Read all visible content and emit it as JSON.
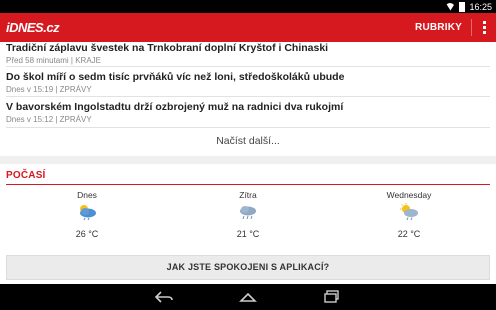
{
  "status_bar": {
    "time": "16:25"
  },
  "action_bar": {
    "logo": "iDNES.cz",
    "menu_label": "RUBRIKY"
  },
  "news": [
    {
      "title": "Tradiční záplavu švestek na Trnkobraní doplní Kryštof i Chinaski",
      "meta": "Před 58 minutami | KRAJE"
    },
    {
      "title": "Do škol míří o sedm tisíc prvňáků víc než loni, středoškoláků ubude",
      "meta": "Dnes v 15:19 | ZPRÁVY"
    },
    {
      "title": "V bavorském Ingolstadtu drží ozbrojený muž na radnici dva rukojmí",
      "meta": "Dnes v 15:12 | ZPRÁVY"
    }
  ],
  "load_more": "Načíst další...",
  "weather": {
    "section_title": "POČASÍ",
    "days": [
      {
        "name": "Dnes",
        "icon": "sun-behind-rain-cloud-icon",
        "temp": "26 °C"
      },
      {
        "name": "Zítra",
        "icon": "cloud-drizzle-icon",
        "temp": "21 °C"
      },
      {
        "name": "Wednesday",
        "icon": "sun-cloud-drizzle-icon",
        "temp": "22 °C"
      }
    ]
  },
  "feedback_button": "JAK JSTE SPOKOJENI S APLIKACÍ?",
  "colors": {
    "brand": "#d6181f",
    "navbar": "#000000"
  }
}
